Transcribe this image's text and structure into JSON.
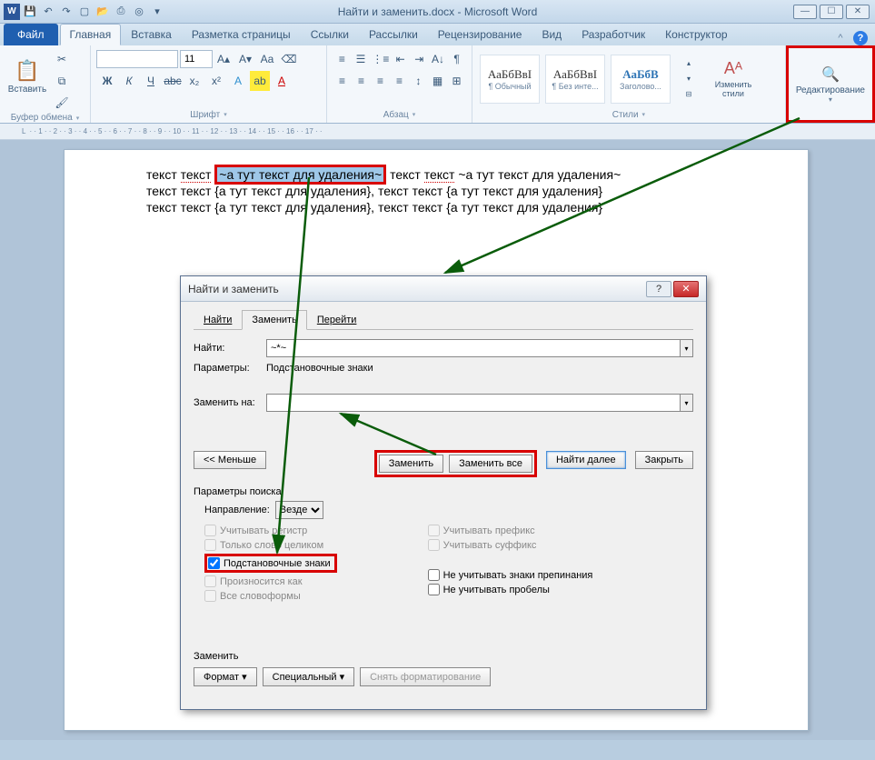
{
  "window": {
    "title": "Найти и заменить.docx - Microsoft Word",
    "controls": {
      "min": "—",
      "max": "☐",
      "close": "✕"
    }
  },
  "qa_icons": [
    "save-icon",
    "undo-icon",
    "redo-icon",
    "new-icon",
    "open-icon",
    "print-icon",
    "preview-icon",
    "zoom-icon"
  ],
  "tabs": {
    "file": "Файл",
    "list": [
      "Главная",
      "Вставка",
      "Разметка страницы",
      "Ссылки",
      "Рассылки",
      "Рецензирование",
      "Вид",
      "Разработчик",
      "Конструктор"
    ],
    "active": "Главная"
  },
  "ribbon": {
    "clipboard": {
      "paste": "Вставить",
      "label": "Буфер обмена"
    },
    "font": {
      "label": "Шрифт",
      "size": "11"
    },
    "paragraph": {
      "label": "Абзац"
    },
    "styles": {
      "label": "Стили",
      "items": [
        {
          "preview": "АаБбВвІ",
          "name": "¶ Обычный"
        },
        {
          "preview": "АаБбВвІ",
          "name": "¶ Без инте..."
        },
        {
          "preview": "АаБбВ",
          "name": "Заголово..."
        }
      ],
      "change": "Изменить стили"
    },
    "editing": {
      "label": "Редактирование"
    }
  },
  "doc": {
    "line1_a": "текст ",
    "line1_t": "текст",
    "line1_sel": "~а тут текст для удаления~",
    "line1_b": " текст ",
    "line1_t2": "текст",
    "line1_c": " ~а тут текст для удаления~",
    "line2": "текст текст {а тут текст для удаления}, текст текст {а тут текст для удаления}",
    "line3": "текст текст {а тут текст для удаления}, текст текст {а тут текст для удаления}"
  },
  "dialog": {
    "title": "Найти и заменить",
    "help": "?",
    "tabs": {
      "find": "Найти",
      "replace": "Заменить",
      "goto": "Перейти"
    },
    "find_label": "Найти:",
    "find_value": "~*~",
    "params_label": "Параметры:",
    "params_value": "Подстановочные знаки",
    "replace_label": "Заменить на:",
    "replace_value": "",
    "less_btn": "<< Меньше",
    "replace_btn": "Заменить",
    "replace_all_btn": "Заменить все",
    "find_next_btn": "Найти далее",
    "close_btn": "Закрыть",
    "search_params_title": "Параметры поиска",
    "direction_label": "Направление:",
    "direction_value": "Везде",
    "opts_left": [
      "Учитывать регистр",
      "Только слово целиком",
      "Подстановочные знаки",
      "Произносится как",
      "Все словоформы"
    ],
    "opts_right": [
      "Учитывать префикс",
      "Учитывать суффикс",
      "Не учитывать знаки препинания",
      "Не учитывать пробелы"
    ],
    "checked_index": 2,
    "replace_section": "Заменить",
    "format_btn": "Формат",
    "special_btn": "Специальный",
    "clear_fmt_btn": "Снять форматирование"
  }
}
